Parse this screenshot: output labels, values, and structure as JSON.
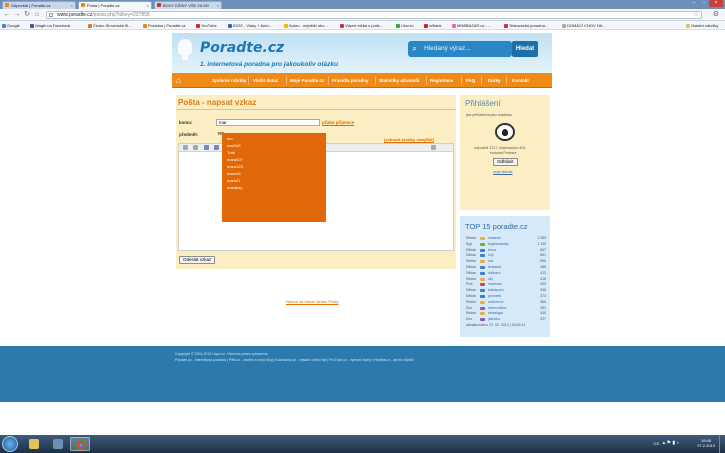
{
  "browser": {
    "tabs": [
      {
        "label": "Odpovědi | Poradte.cz",
        "active": false
      },
      {
        "label": "Pošta | Poradte.cz",
        "active": true
      },
      {
        "label": "BOXY DŽINY VŠE ZA 99!",
        "active": false
      }
    ],
    "url_host": "www.poradte.cz",
    "url_path": "/posta.php?idkey=237858",
    "bookmarks": [
      "Google",
      "Wagle na Facebook",
      "Česko-Slovenské fil...",
      "Poradna | Poradte.cz",
      "YouTube",
      "IDOS - Vlaky + Auto...",
      "Aukro - největší obc...",
      "Vtipné trička s potis...",
      "Uloz.to",
      "mBank",
      "MIMIBAZAR.cz - ...",
      "Testovácká poradna...",
      "DOMÁCÍ CHOV HA..."
    ],
    "other_bookmarks": "Ostatní záložky"
  },
  "site": {
    "logo": "Poradte.cz",
    "tagline": "1. internetová poradna pro jakoukoliv otázku",
    "search_placeholder": "Hledaný výraz...",
    "search_button": "Hledat",
    "menu": [
      "Správné rubriky",
      "Vložit dotaz",
      "Moje Poradte.cz",
      "Pravidla poradny",
      "Statistiky uživatelů",
      "Registrace",
      "FAQ",
      "Dárky",
      "Kontakt"
    ]
  },
  "compose": {
    "title": "Pošta - napsat vzkaz",
    "to_label": "komu:",
    "to_value": "mar",
    "add_recipient": "přidat příjemce",
    "subject_label": "předmět:",
    "subject_value": "RE",
    "show_smileys": "[zobrazit zkratky smajlíků]",
    "send_button": "Odeslat vzkaz",
    "back_link": "Návrat na hlavní stranu  Pošty"
  },
  "autocomplete": [
    "mo",
    "mar345",
    "Traš",
    "mara007",
    "mara123",
    "mara16",
    "mara21",
    "marakey"
  ],
  "login_box": {
    "title": "Přihlášení",
    "logged_as": "jste přihlášen/a jako martinaa",
    "stats1": "odpovědí 2217, hlasovaných 404",
    "stats2": "hodnost Profesor",
    "logout": "Odhlásit",
    "my_stats": "moje aktivita"
  },
  "top15": {
    "title": "TOP 15 poradte.cz",
    "rows": [
      {
        "rank": "Rektor",
        "name": "misanek",
        "pts": "1 283",
        "color": "#e8b23a"
      },
      {
        "rank": "Syp",
        "name": "kapitanalahip",
        "pts": "1 130",
        "color": "#6fae3a"
      },
      {
        "rank": "Děkan",
        "name": "levoz",
        "pts": "667",
        "color": "#3a7fc8"
      },
      {
        "rank": "Děkan",
        "name": "hoji",
        "pts": "661",
        "color": "#3a7fc8"
      },
      {
        "rank": "Rektor",
        "name": "lois",
        "pts": "596",
        "color": "#e8b23a"
      },
      {
        "rank": "Děkan",
        "name": "ledasdal",
        "pts": "485",
        "color": "#3a7fc8"
      },
      {
        "rank": "Děkan",
        "name": "didinara",
        "pts": "423",
        "color": "#3a7fc8"
      },
      {
        "rank": "Rektor",
        "name": "vily",
        "pts": "418",
        "color": "#e8b23a"
      },
      {
        "rank": "Prof",
        "name": "martinaa",
        "pts": "403",
        "color": "#c84a3a"
      },
      {
        "rank": "Děkan",
        "name": "katrlauzov",
        "pts": "396",
        "color": "#3a7fc8"
      },
      {
        "rank": "Děkan",
        "name": "gonzeek",
        "pts": "374",
        "color": "#3a7fc8"
      },
      {
        "rank": "Rektor",
        "name": "wolnerxxx",
        "pts": "366",
        "color": "#e8b23a"
      },
      {
        "rank": "Doc",
        "name": "rebenvektor",
        "pts": "351",
        "color": "#8b5ab5"
      },
      {
        "rank": "Rektor",
        "name": "kelxalaga",
        "pts": "340",
        "color": "#e8b23a"
      },
      {
        "rank": "Doc",
        "name": "jabrabu",
        "pts": "327",
        "color": "#8b5ab5"
      }
    ],
    "updated": "aktualizováno: 27. 02. 2013 | 15:06:31"
  },
  "footer": {
    "line1": "Copyright © 2004-2013 Hapo.cz. Všechna práva vyhrazena.",
    "line2": "Poradte.cz - internetová poradna | Piffa.cz - úsměv a nový blog | Kuchianny.cz - vejsadí vnitro mýt | ProTube.cz - vyznání barvy | Hepšta.cz - archiv článků"
  },
  "taskbar": {
    "lang": "CS",
    "time": "16:06",
    "date": "27.2.2013"
  }
}
